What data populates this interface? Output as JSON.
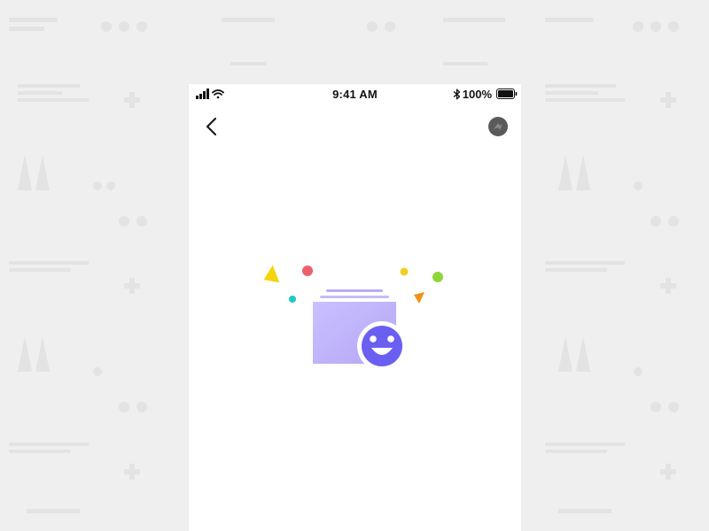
{
  "status_bar": {
    "time": "9:41 AM",
    "battery": "100%",
    "icons": [
      "signal-icon",
      "wifi-icon",
      "bluetooth-icon",
      "battery-icon"
    ]
  },
  "nav": {
    "back_icon": "chevron-left-icon",
    "avatar_icon": "user-avatar"
  },
  "illustration": {
    "icon": "smiley-folder-illustration",
    "confetti_colors": [
      "#f4d50b",
      "#ef5f6b",
      "#21c8c3",
      "#f1cf1f",
      "#8fd63b",
      "#f1901d"
    ]
  },
  "colors": {
    "accent": "#6b5ff2",
    "folder_top": "#c9c0ff",
    "folder_bottom": "#b6a6f6",
    "page_lines": "#b8aef5",
    "background": "#efefef",
    "screen": "#ffffff"
  }
}
